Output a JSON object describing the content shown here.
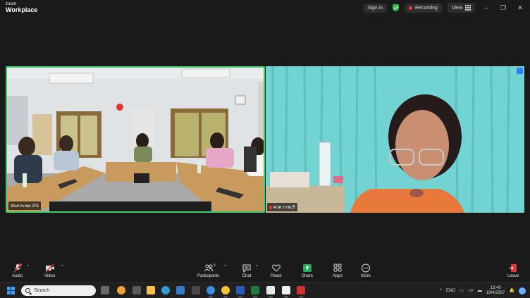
{
  "app": {
    "brand_small": "zoom",
    "brand_large": "Workplace"
  },
  "topbar": {
    "sign_in": "Sign in",
    "recording": "Recording",
    "view": "View"
  },
  "participants": [
    {
      "name": "ห้องประชุม 201",
      "muted": false
    },
    {
      "name": "ศวพ.ราชบุรี",
      "muted": true
    }
  ],
  "toolbar": {
    "audio": "Audio",
    "video": "Video",
    "participants": "Participants",
    "participants_count": "5",
    "chat": "Chat",
    "react": "React",
    "share": "Share",
    "apps": "Apps",
    "more": "More",
    "leave": "Leave"
  },
  "taskbar": {
    "search_placeholder": "Search",
    "language": "ENG",
    "time": "13:40",
    "date": "19/4/2567"
  },
  "colors": {
    "active_speaker_border": "#3ccf66",
    "recording_red": "#e53935",
    "share_green": "#1fae4b",
    "accent_blue": "#2f7bff"
  }
}
